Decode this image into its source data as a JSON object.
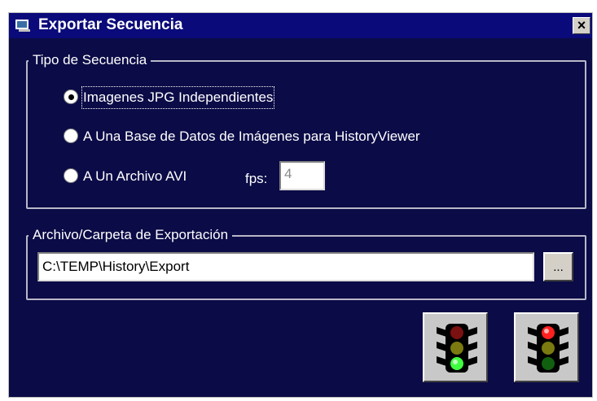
{
  "window": {
    "title": "Exportar Secuencia",
    "close_label": "×"
  },
  "sequence_type": {
    "group_label": "Tipo de Secuencia",
    "options": [
      {
        "label": "Imagenes JPG Independientes",
        "selected": true
      },
      {
        "label": "A Una Base de Datos de Imágenes para HistoryViewer",
        "selected": false
      },
      {
        "label": "A Un Archivo AVI",
        "selected": false
      }
    ],
    "fps_label": "fps:",
    "fps_value": "4"
  },
  "export_target": {
    "group_label": "Archivo/Carpeta de Exportación",
    "path_value": "C:\\TEMP\\History\\Export",
    "browse_label": "..."
  },
  "actions": {
    "ok_icon": "traffic-light-green-icon",
    "cancel_icon": "traffic-light-red-icon"
  },
  "colors": {
    "background": "#0b0b47",
    "titlebar": "#0a0a7a",
    "light_red_on": "#ff2020",
    "light_green_on": "#40ff40"
  }
}
